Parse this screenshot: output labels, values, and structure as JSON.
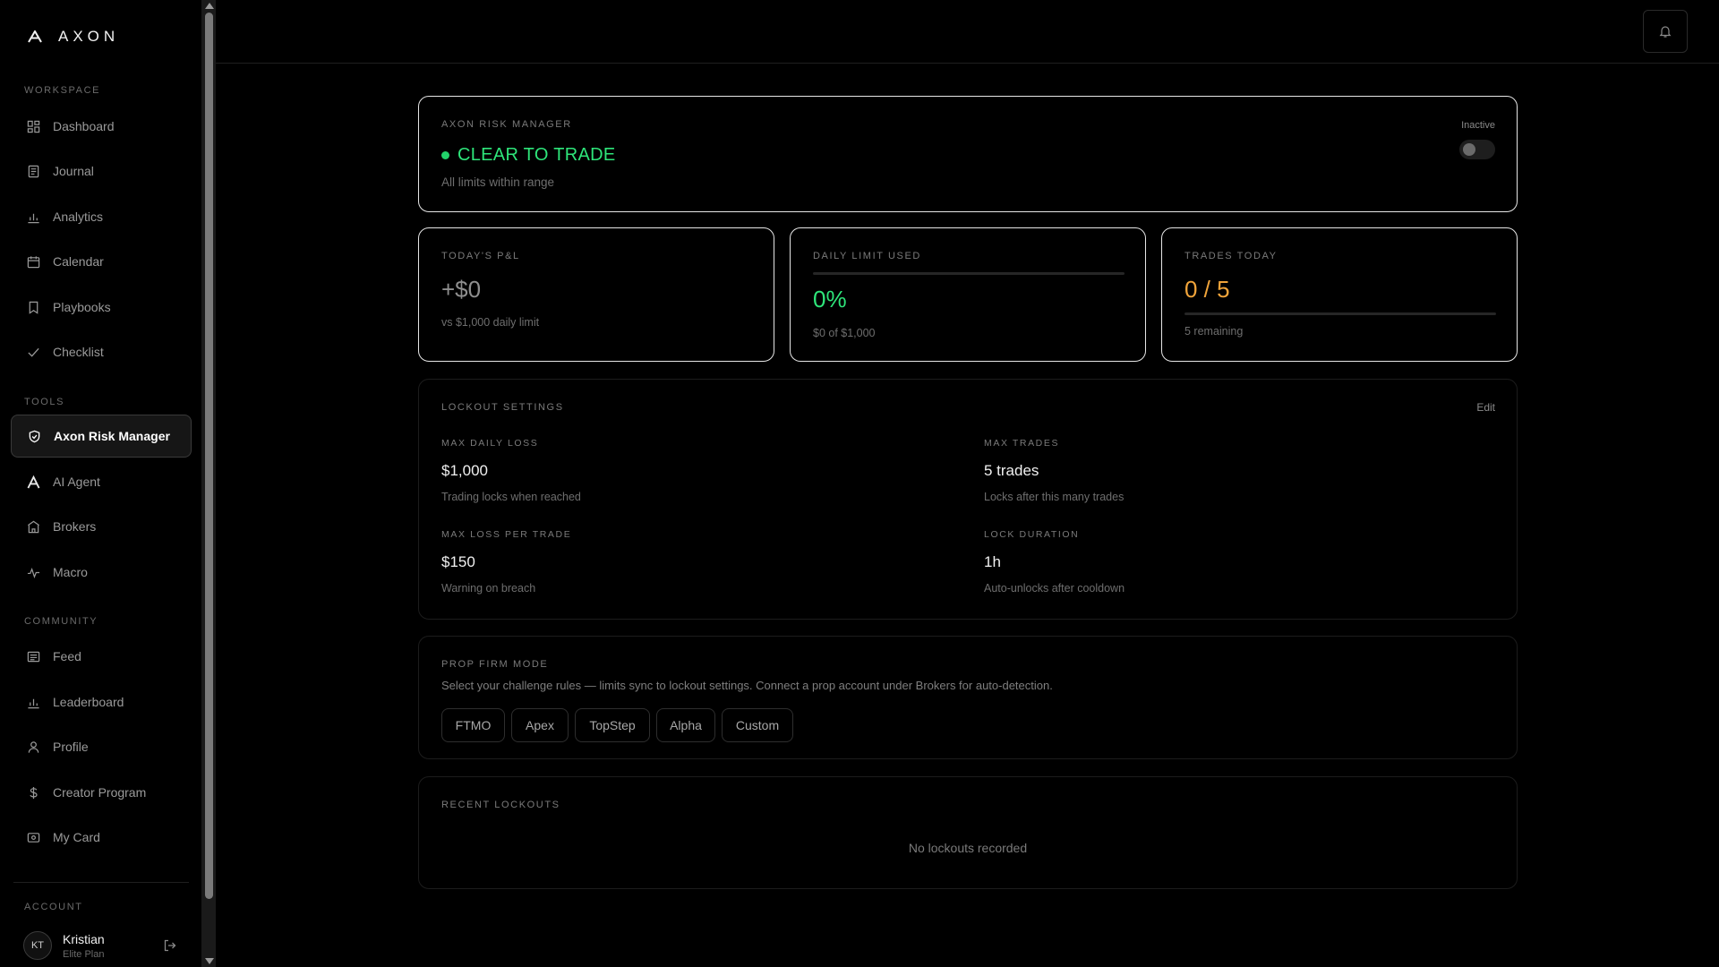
{
  "app": {
    "name": "AXON"
  },
  "sidebar": {
    "workspace_label": "WORKSPACE",
    "tools_label": "TOOLS",
    "community_label": "COMMUNITY",
    "account_label": "ACCOUNT",
    "workspace": [
      {
        "label": "Dashboard",
        "icon": "grid-icon"
      },
      {
        "label": "Journal",
        "icon": "journal-icon"
      },
      {
        "label": "Analytics",
        "icon": "bar-chart-icon"
      },
      {
        "label": "Calendar",
        "icon": "calendar-icon"
      },
      {
        "label": "Playbooks",
        "icon": "bookmark-icon"
      },
      {
        "label": "Checklist",
        "icon": "check-icon"
      }
    ],
    "tools": [
      {
        "label": "Axon Risk Manager",
        "icon": "shield-icon",
        "active": true
      },
      {
        "label": "AI Agent",
        "icon": "axon-logo-icon"
      },
      {
        "label": "Brokers",
        "icon": "bank-icon"
      },
      {
        "label": "Macro",
        "icon": "pulse-icon"
      }
    ],
    "community": [
      {
        "label": "Feed",
        "icon": "feed-icon"
      },
      {
        "label": "Leaderboard",
        "icon": "bar-chart-icon"
      },
      {
        "label": "Profile",
        "icon": "user-icon"
      },
      {
        "label": "Creator Program",
        "icon": "dollar-icon"
      },
      {
        "label": "My Card",
        "icon": "card-icon"
      }
    ],
    "account": {
      "initials": "KT",
      "name": "Kristian",
      "plan": "Elite Plan"
    }
  },
  "risk": {
    "label": "AXON RISK MANAGER",
    "status": "CLEAR TO TRADE",
    "sub": "All limits within range",
    "toggle_label": "Inactive",
    "toggle_on": false
  },
  "pnl": {
    "label": "TODAY'S P&L",
    "value": "+$0",
    "sub": "vs $1,000 daily limit"
  },
  "limit": {
    "label": "DAILY LIMIT USED",
    "value": "0%",
    "sub": "$0 of $1,000",
    "fraction": 0
  },
  "trades": {
    "label": "TRADES TODAY",
    "value": "0 / 5",
    "sub": "5 remaining",
    "fraction": 0
  },
  "lockout": {
    "label": "LOCKOUT SETTINGS",
    "edit": "Edit",
    "max_daily_loss": {
      "label": "MAX DAILY LOSS",
      "value": "$1,000",
      "sub": "Trading locks when reached"
    },
    "max_trades": {
      "label": "MAX TRADES",
      "value": "5 trades",
      "sub": "Locks after this many trades"
    },
    "max_loss_per_trade": {
      "label": "MAX LOSS PER TRADE",
      "value": "$150",
      "sub": "Warning on breach"
    },
    "lock_duration": {
      "label": "LOCK DURATION",
      "value": "1h",
      "sub": "Auto-unlocks after cooldown"
    }
  },
  "prop": {
    "label": "PROP FIRM MODE",
    "desc": "Select your challenge rules — limits sync to lockout settings. Connect a prop account under Brokers for auto-detection.",
    "options": [
      "FTMO",
      "Apex",
      "TopStep",
      "Alpha",
      "Custom"
    ]
  },
  "recent": {
    "label": "RECENT LOCKOUTS",
    "empty": "No lockouts recorded"
  },
  "colors": {
    "accent_green": "#2ee57a",
    "accent_amber": "#f0a43a",
    "border_bright": "#e6e6e6"
  }
}
